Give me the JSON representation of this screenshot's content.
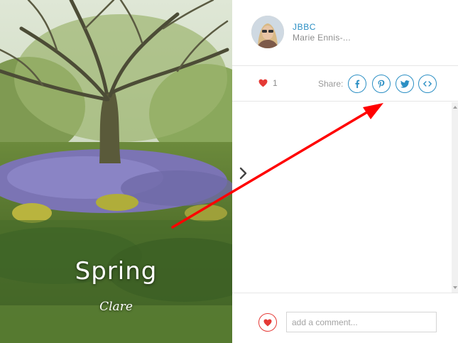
{
  "photo": {
    "title": "Spring",
    "subtitle": "Clare"
  },
  "header": {
    "group_name": "JBBC",
    "user_name": "Marie Ennis-..."
  },
  "actions": {
    "like_count": "1",
    "share_label": "Share:",
    "share_icons": [
      "facebook-icon",
      "pinterest-icon",
      "twitter-icon",
      "embed-icon"
    ]
  },
  "footer": {
    "comment_placeholder": "add a comment..."
  },
  "colors": {
    "accent": "#2b8fc4",
    "heart": "#e53935",
    "annotation_arrow": "#ff0000"
  }
}
